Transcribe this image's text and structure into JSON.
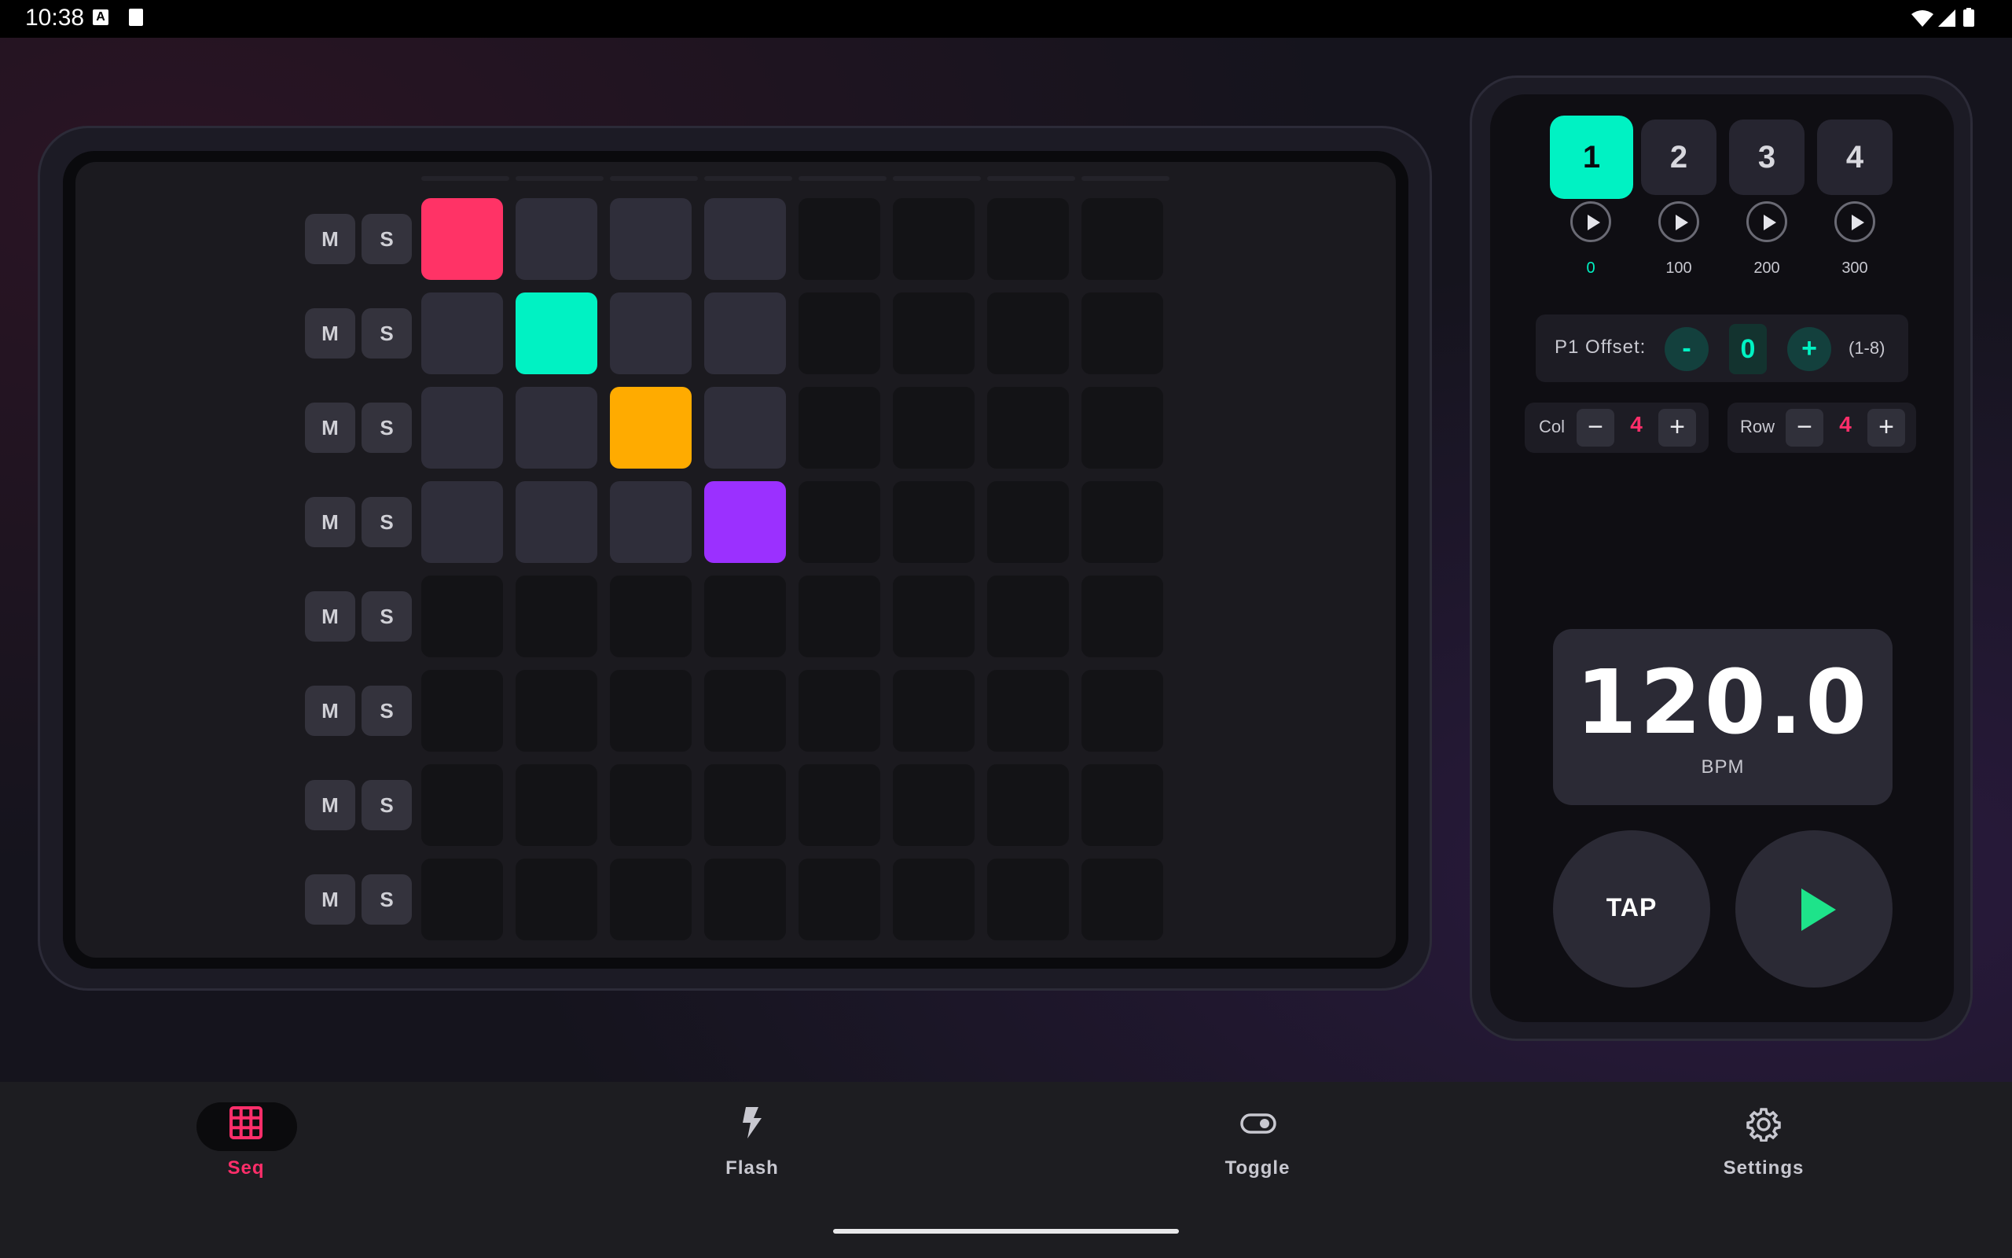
{
  "status": {
    "time": "10:38",
    "keyboard_glyph": "A"
  },
  "sequencer": {
    "rows": [
      {
        "mute": "M",
        "solo": "S"
      },
      {
        "mute": "M",
        "solo": "S"
      },
      {
        "mute": "M",
        "solo": "S"
      },
      {
        "mute": "M",
        "solo": "S"
      },
      {
        "mute": "M",
        "solo": "S"
      },
      {
        "mute": "M",
        "solo": "S"
      },
      {
        "mute": "M",
        "solo": "S"
      },
      {
        "mute": "M",
        "solo": "S"
      }
    ],
    "active_columns": 4,
    "active_rows": 4,
    "lit_cells": [
      {
        "row": 0,
        "col": 0,
        "color": "#ff3366"
      },
      {
        "row": 1,
        "col": 1,
        "color": "#00f2c3"
      },
      {
        "row": 2,
        "col": 2,
        "color": "#ffab00"
      },
      {
        "row": 3,
        "col": 3,
        "color": "#9b30ff"
      }
    ]
  },
  "patterns": {
    "items": [
      {
        "label": "1",
        "offset": "0",
        "active": true
      },
      {
        "label": "2",
        "offset": "100",
        "active": false
      },
      {
        "label": "3",
        "offset": "200",
        "active": false
      },
      {
        "label": "4",
        "offset": "300",
        "active": false
      }
    ]
  },
  "offset": {
    "label": "P1 Offset:",
    "minus": "-",
    "value": "0",
    "plus": "+",
    "range": "(1-8)"
  },
  "dims": {
    "col": {
      "label": "Col",
      "minus": "−",
      "value": "4",
      "plus": "+"
    },
    "row": {
      "label": "Row",
      "minus": "−",
      "value": "4",
      "plus": "+"
    }
  },
  "tempo": {
    "bpm": "120.0",
    "unit": "BPM"
  },
  "controls": {
    "tap": "TAP",
    "play_icon": "play-icon"
  },
  "colors": {
    "accent": "#00f2c3",
    "pink": "#ff2e6a",
    "amber": "#ffab00",
    "purple": "#9b30ff",
    "play_green": "#1ee38a"
  },
  "nav": {
    "items": [
      {
        "label": "Seq",
        "icon": "grid-icon",
        "active": true
      },
      {
        "label": "Flash",
        "icon": "bolt-icon",
        "active": false
      },
      {
        "label": "Toggle",
        "icon": "toggle-icon",
        "active": false
      },
      {
        "label": "Settings",
        "icon": "gear-icon",
        "active": false
      }
    ]
  }
}
